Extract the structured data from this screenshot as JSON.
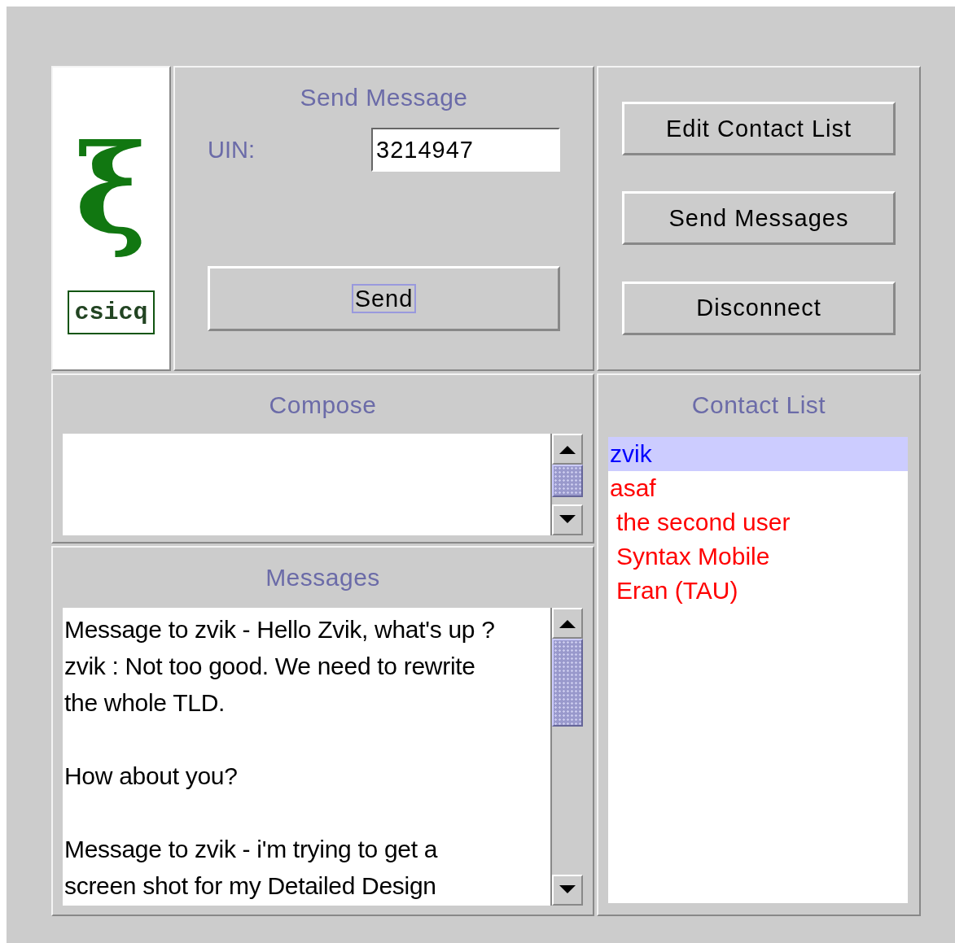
{
  "logo": {
    "symbol": "ξ",
    "label": "csicq"
  },
  "send_message": {
    "title": "Send Message",
    "uin_label": "UIN:",
    "uin_value": "3214947",
    "send_button": "Send"
  },
  "actions": [
    "Edit Contact List",
    "Send Messages",
    "Disconnect"
  ],
  "compose": {
    "title": "Compose"
  },
  "messages": {
    "title": "Messages",
    "paragraphs": [
      {
        "lines": [
          "Message to zvik  - Hello Zvik, what's up ?",
          "zvik : Not too good. We need to rewrite",
          "the whole TLD."
        ]
      },
      {
        "lines": [
          "How about you?"
        ]
      },
      {
        "lines": [
          "Message to zvik  - i'm trying to get a",
          "screen shot for my Detailed Design"
        ]
      }
    ]
  },
  "contact_list": {
    "title": "Contact List",
    "contacts": [
      {
        "name": "zvik",
        "selected": true,
        "indented": false
      },
      {
        "name": "asaf",
        "selected": false,
        "indented": false
      },
      {
        "name": "the second user",
        "selected": false,
        "indented": true
      },
      {
        "name": "Syntax Mobile",
        "selected": false,
        "indented": true
      },
      {
        "name": "Eran (TAU)",
        "selected": false,
        "indented": true
      }
    ]
  }
}
